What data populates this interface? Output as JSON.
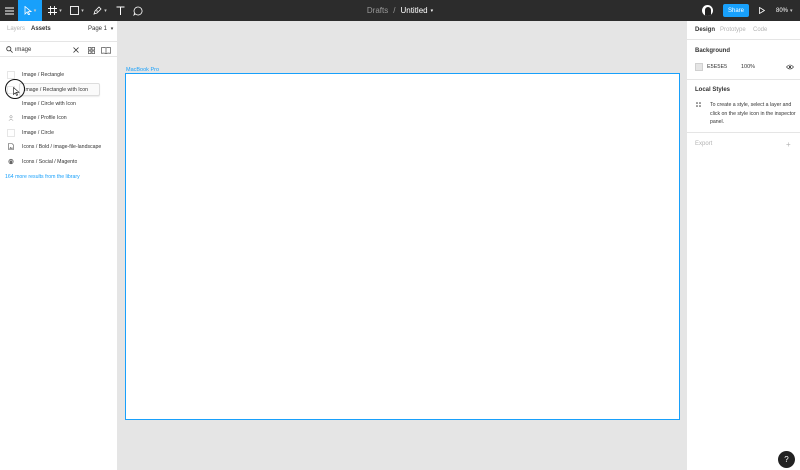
{
  "toolbar": {
    "breadcrumb": "Drafts",
    "separator": "/",
    "file_name": "Untitled",
    "share_label": "Share",
    "zoom_label": "80%"
  },
  "left_panel": {
    "tabs": [
      {
        "label": "Layers",
        "active": false
      },
      {
        "label": "Assets",
        "active": true
      }
    ],
    "page_selector": "Page 1",
    "search_value": "image",
    "assets": [
      {
        "label": "Image / Rectangle",
        "icon": "rectangle-thumb"
      },
      {
        "label": "Image / Rectangle with Icon",
        "icon": "rectangle-icon-thumb"
      },
      {
        "label": "Image / Circle with Icon",
        "icon": "circle-icon-thumb"
      },
      {
        "label": "Image / Profile Icon",
        "icon": "profile-icon-thumb"
      },
      {
        "label": "Image / Circle",
        "icon": "circle-thumb"
      },
      {
        "label": "Icons / Bold / image-file-landscape",
        "icon": "image-file-icon"
      },
      {
        "label": "Icons / Social / Magento",
        "icon": "magento-icon"
      }
    ],
    "more_results": "164 more results from the library"
  },
  "canvas": {
    "frame_label": "MacBook Pro"
  },
  "right_panel": {
    "tabs": [
      {
        "label": "Design",
        "active": true
      },
      {
        "label": "Prototype",
        "active": false
      },
      {
        "label": "Code",
        "active": false
      }
    ],
    "background_title": "Background",
    "background_hex": "E5E5E5",
    "background_opacity": "100%",
    "local_styles_title": "Local Styles",
    "local_styles_desc": "To create a style, select a layer and click on the style icon in the inspector panel.",
    "export_title": "Export"
  },
  "colors": {
    "accent": "#18a0fb",
    "toolbar_bg": "#2c2c2c",
    "canvas_bg": "#e5e5e5"
  },
  "help_label": "?"
}
